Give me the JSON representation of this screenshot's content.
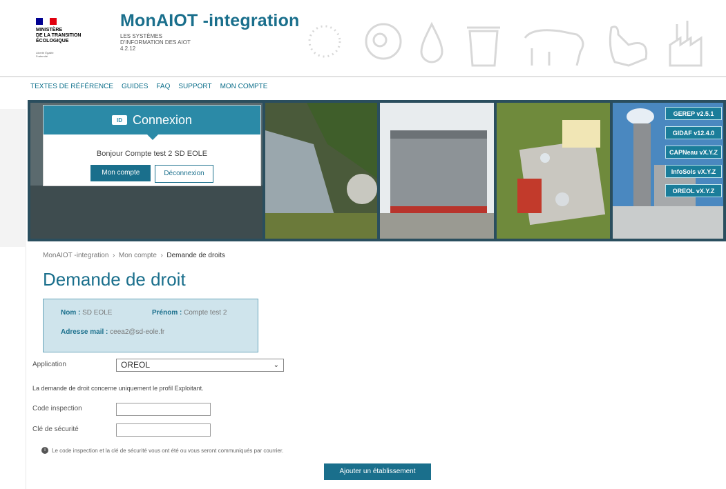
{
  "header": {
    "ministry": "MINISTÈRE\nDE LA TRANSITION\nÉCOLOGIQUE",
    "ministry_small": "Liberté Égalité Fraternité",
    "app_title": "MonAIOT -integration",
    "app_subtitle": "LES SYSTÈMES D'INFORMATION DES AIOT 4.2.12"
  },
  "nav": [
    "TEXTES DE RÉFÉRENCE",
    "GUIDES",
    "FAQ",
    "SUPPORT",
    "MON COMPTE"
  ],
  "login": {
    "title": "Connexion",
    "greeting": "Bonjour Compte test 2 SD EOLE",
    "account_button": "Mon compte",
    "logout_button": "Déconnexion"
  },
  "apps": [
    "GEREP v2.5.1",
    "GIDAF v12.4.0",
    "CAPNeau vX.Y.Z",
    "InfoSols vX.Y.Z",
    "OREOL vX.Y.Z"
  ],
  "breadcrumb": [
    "MonAIOT -integration",
    "Mon compte",
    "Demande de droits"
  ],
  "page_title": "Demande de droit",
  "user": {
    "nom_label": "Nom :",
    "nom_value": "SD EOLE",
    "prenom_label": "Prénom :",
    "prenom_value": "Compte test 2",
    "email_label": "Adresse mail :",
    "email_value": "ceea2@sd-eole.fr"
  },
  "form": {
    "application_label": "Application",
    "application_value": "OREOL",
    "note": "La demande de droit concerne uniquement le profil Exploitant.",
    "code_label": "Code inspection",
    "cle_label": "Clé de sécurité",
    "help": "Le code inspection et la clé de sécurité vous ont été ou vous seront communiqués par courrier.",
    "add_button": "Ajouter un établissement"
  },
  "colors": {
    "primary": "#1a6f8c",
    "accent": "#2b8aa7",
    "info_bg": "#cfe4ec"
  }
}
